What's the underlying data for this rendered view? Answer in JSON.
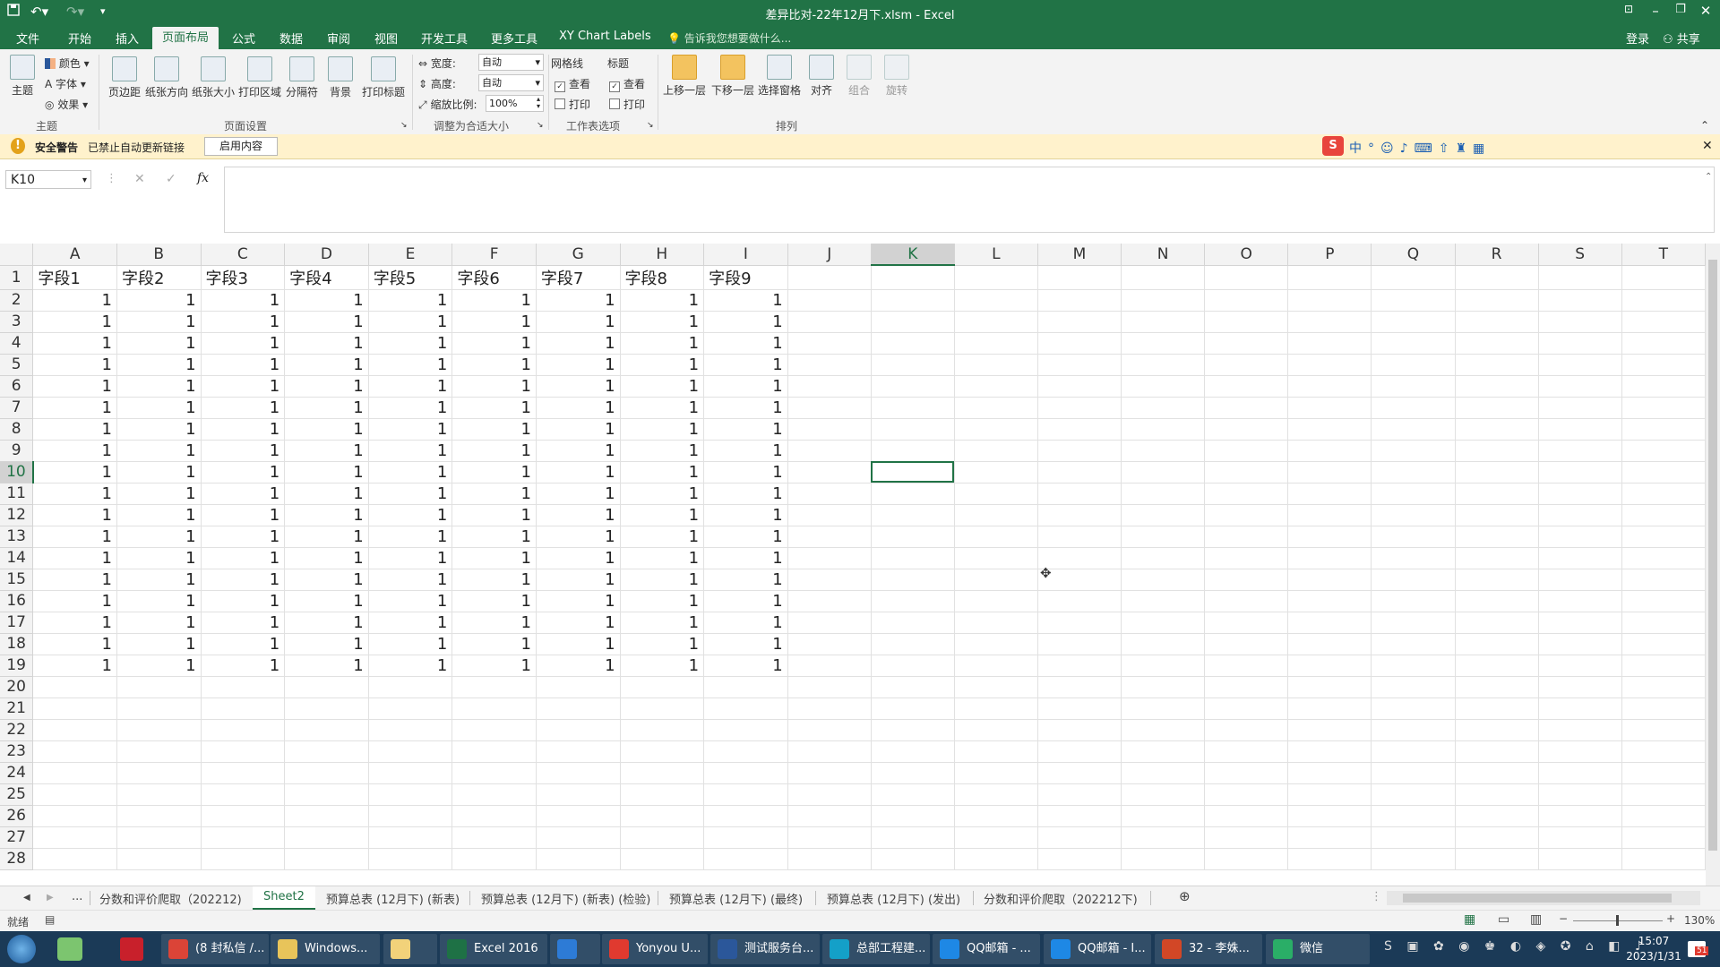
{
  "window": {
    "title": "差异比对-22年12月下.xlsm - Excel"
  },
  "quick_access": {
    "save_icon": "save-icon",
    "undo_icon": "undo-icon",
    "redo_icon": "redo-icon"
  },
  "ribbon_tabs": [
    "文件",
    "开始",
    "插入",
    "页面布局",
    "公式",
    "数据",
    "审阅",
    "视图",
    "开发工具",
    "更多工具",
    "XY Chart Labels"
  ],
  "active_tab": "页面布局",
  "tell_me": "告诉我您想要做什么...",
  "account": {
    "login": "登录",
    "share": "共享"
  },
  "ribbon": {
    "theme_group": {
      "label": "主题",
      "themes": "主题",
      "colors": "颜色",
      "fonts": "字体",
      "effects": "效果"
    },
    "page_setup_group": {
      "label": "页面设置",
      "buttons": [
        "页边距",
        "纸张方向",
        "纸张大小",
        "打印区域",
        "分隔符",
        "背景",
        "打印标题"
      ]
    },
    "scale_group": {
      "label": "调整为合适大小",
      "width_label": "宽度:",
      "width_value": "自动",
      "height_label": "高度:",
      "height_value": "自动",
      "scale_label": "缩放比例:",
      "scale_value": "100%"
    },
    "sheet_options_group": {
      "label": "工作表选项",
      "gridlines": "网格线",
      "headings": "标题",
      "view": "查看",
      "print": "打印"
    },
    "arrange_group": {
      "label": "排列",
      "buttons": [
        "上移一层",
        "下移一层",
        "选择窗格",
        "对齐",
        "组合",
        "旋转"
      ]
    }
  },
  "message_bar": {
    "title": "安全警告",
    "text": "已禁止自动更新链接",
    "button": "启用内容"
  },
  "formula_bar": {
    "name_box": "K10",
    "cancel": "✕",
    "enter": "✓",
    "fx": "fx",
    "content": ""
  },
  "sheet": {
    "columns": [
      "A",
      "B",
      "C",
      "D",
      "E",
      "F",
      "G",
      "H",
      "I",
      "J",
      "K",
      "L",
      "M",
      "N",
      "O",
      "P",
      "Q",
      "R",
      "S",
      "T"
    ],
    "header_row": [
      "字段1",
      "字段2",
      "字段3",
      "字段4",
      "字段5",
      "字段6",
      "字段7",
      "字段8",
      "字段9"
    ],
    "data_rows": [
      [
        1,
        1,
        1,
        1,
        1,
        1,
        1,
        1,
        1
      ],
      [
        1,
        1,
        1,
        1,
        1,
        1,
        1,
        1,
        1
      ],
      [
        1,
        1,
        1,
        1,
        1,
        1,
        1,
        1,
        1
      ],
      [
        1,
        1,
        1,
        1,
        1,
        1,
        1,
        1,
        1
      ],
      [
        1,
        1,
        1,
        1,
        1,
        1,
        1,
        1,
        1
      ],
      [
        1,
        1,
        1,
        1,
        1,
        1,
        1,
        1,
        1
      ],
      [
        1,
        1,
        1,
        1,
        1,
        1,
        1,
        1,
        1
      ],
      [
        1,
        1,
        1,
        1,
        1,
        1,
        1,
        1,
        1
      ],
      [
        1,
        1,
        1,
        1,
        1,
        1,
        1,
        1,
        1
      ],
      [
        1,
        1,
        1,
        1,
        1,
        1,
        1,
        1,
        1
      ],
      [
        1,
        1,
        1,
        1,
        1,
        1,
        1,
        1,
        1
      ],
      [
        1,
        1,
        1,
        1,
        1,
        1,
        1,
        1,
        1
      ],
      [
        1,
        1,
        1,
        1,
        1,
        1,
        1,
        1,
        1
      ],
      [
        1,
        1,
        1,
        1,
        1,
        1,
        1,
        1,
        1
      ],
      [
        1,
        1,
        1,
        1,
        1,
        1,
        1,
        1,
        1
      ],
      [
        1,
        1,
        1,
        1,
        1,
        1,
        1,
        1,
        1
      ],
      [
        1,
        1,
        1,
        1,
        1,
        1,
        1,
        1,
        1
      ],
      [
        1,
        1,
        1,
        1,
        1,
        1,
        1,
        1,
        1
      ]
    ],
    "row_numbers": [
      1,
      2,
      3,
      4,
      5,
      6,
      7,
      8,
      9,
      10,
      11,
      12,
      13,
      14,
      15,
      16,
      17,
      18,
      19,
      20,
      21,
      22,
      23,
      24,
      25,
      26,
      27,
      28
    ],
    "active_cell": "K10"
  },
  "sheet_tabs": {
    "more": "...",
    "tabs": [
      "分数和评价爬取（202212)",
      "Sheet2",
      "预算总表 (12月下) (新表)",
      "预算总表 (12月下) (新表) (检验)",
      "预算总表 (12月下) (最终)",
      "预算总表 (12月下) (发出)",
      "分数和评价爬取（202212下)"
    ],
    "active": "Sheet2"
  },
  "status_bar": {
    "mode": "就绪",
    "zoom": "130%"
  },
  "taskbar": {
    "items": [
      {
        "label": "(8 封私信 /...",
        "color": "#db4437"
      },
      {
        "label": "Windows...",
        "color": "#e8c45a"
      },
      {
        "label": "",
        "color": "#f2d27a"
      },
      {
        "label": "Excel 2016",
        "color": "#1e7145"
      },
      {
        "label": "",
        "color": "#2d7bd6"
      },
      {
        "label": "Yonyou U...",
        "color": "#e03a2f"
      },
      {
        "label": "测试服务台...",
        "color": "#2b579a"
      },
      {
        "label": "总部工程建...",
        "color": "#14a0c8"
      },
      {
        "label": "QQ邮箱 - ...",
        "color": "#1e88e5"
      },
      {
        "label": "QQ邮箱 - I...",
        "color": "#1e88e5"
      },
      {
        "label": "32 - 李姝...",
        "color": "#d24726"
      },
      {
        "label": "微信",
        "color": "#2aae67"
      }
    ],
    "time": "15:07",
    "date": "2023/1/31",
    "notification_count": "51"
  }
}
